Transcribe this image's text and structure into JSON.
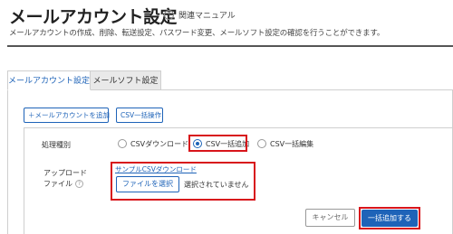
{
  "header": {
    "title": "メールアカウント設定",
    "help_icon": "help-circle-icon",
    "help_text": "関連マニュアル",
    "description": "メールアカウントの作成、削除、転送設定、パスワード変更、メールソフト設定の確認を行うことができます。"
  },
  "tabs": [
    {
      "label": "メールアカウント設定",
      "active": true
    },
    {
      "label": "メールソフト設定",
      "active": false
    }
  ],
  "actions": {
    "add_account": "＋メールアカウントを追加",
    "csv_bulk": "CSV一括操作"
  },
  "form": {
    "type_label": "処理種別",
    "options": [
      {
        "label": "CSVダウンロード",
        "checked": false
      },
      {
        "label": "CSV一括追加",
        "checked": true
      },
      {
        "label": "CSV一括編集",
        "checked": false
      }
    ],
    "upload_label_1": "アップロード",
    "upload_label_2": "ファイル",
    "info_icon": "?",
    "sample_link": "サンプルCSVダウンロード",
    "file_button": "ファイルを選択",
    "file_status": "選択されていません"
  },
  "footer": {
    "cancel": "キャンセル",
    "submit": "一括追加する"
  },
  "colors": {
    "accent": "#1e63b8",
    "highlight": "#d8151b"
  }
}
